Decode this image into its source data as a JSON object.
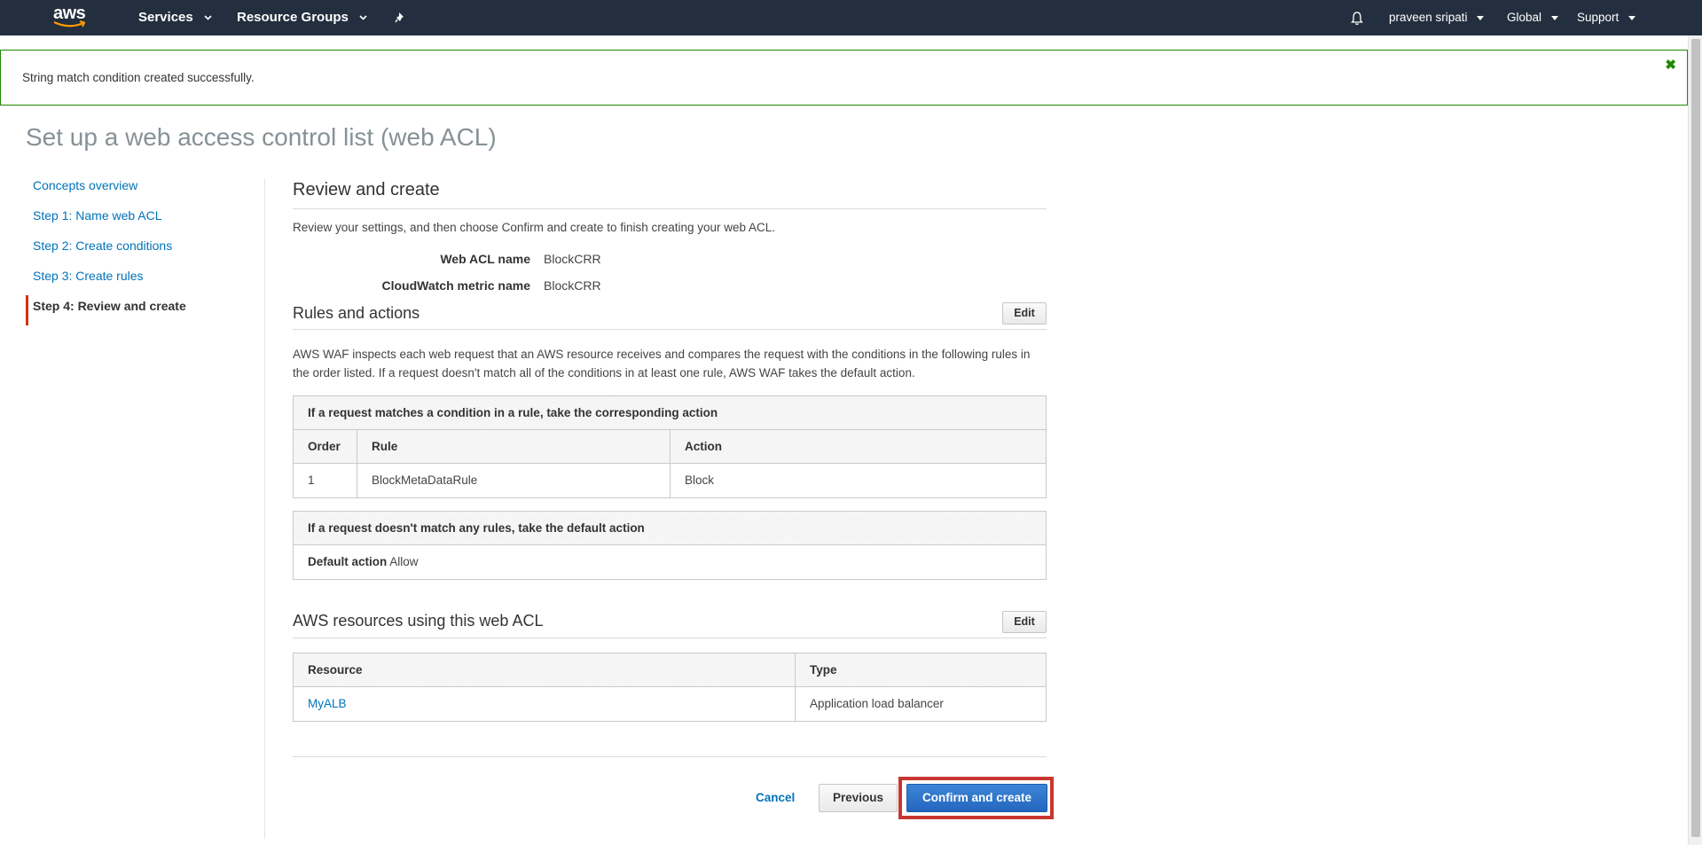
{
  "topnav": {
    "logo": "aws",
    "services": "Services",
    "resource_groups": "Resource Groups",
    "user": "praveen sripati",
    "region": "Global",
    "support": "Support"
  },
  "banner": {
    "message": "String match condition created successfully."
  },
  "page_title": "Set up a web access control list (web ACL)",
  "steps": [
    {
      "label": "Concepts overview"
    },
    {
      "label": "Step 1: Name web ACL"
    },
    {
      "label": "Step 2: Create conditions"
    },
    {
      "label": "Step 3: Create rules"
    },
    {
      "label": "Step 4: Review and create"
    }
  ],
  "review": {
    "heading": "Review and create",
    "intro": "Review your settings, and then choose Confirm and create to finish creating your web ACL.",
    "web_acl_name_label": "Web ACL name",
    "web_acl_name_value": "BlockCRR",
    "metric_label": "CloudWatch metric name",
    "metric_value": "BlockCRR"
  },
  "rules": {
    "heading": "Rules and actions",
    "edit": "Edit",
    "description": "AWS WAF inspects each web request that an AWS resource receives and compares the request with the conditions in the following rules in the order listed. If a request doesn't match all of the conditions in at least one rule, AWS WAF takes the default action.",
    "table_caption": "If a request matches a condition in a rule, take the corresponding action",
    "columns": [
      "Order",
      "Rule",
      "Action"
    ],
    "rows": [
      {
        "order": "1",
        "rule": "BlockMetaDataRule",
        "action": "Block"
      }
    ],
    "default_caption": "If a request doesn't match any rules, take the default action",
    "default_label": "Default action",
    "default_value": "Allow"
  },
  "resources": {
    "heading": "AWS resources using this web ACL",
    "edit": "Edit",
    "columns": [
      "Resource",
      "Type"
    ],
    "rows": [
      {
        "resource": "MyALB",
        "type": "Application load balancer"
      }
    ]
  },
  "footer": {
    "cancel": "Cancel",
    "previous": "Previous",
    "confirm": "Confirm and create"
  },
  "colors": {
    "nav_bg": "#232f3e",
    "link": "#0073bb",
    "success": "#1e8900",
    "primary_button": "#2466bf",
    "highlight": "#c7372f"
  }
}
